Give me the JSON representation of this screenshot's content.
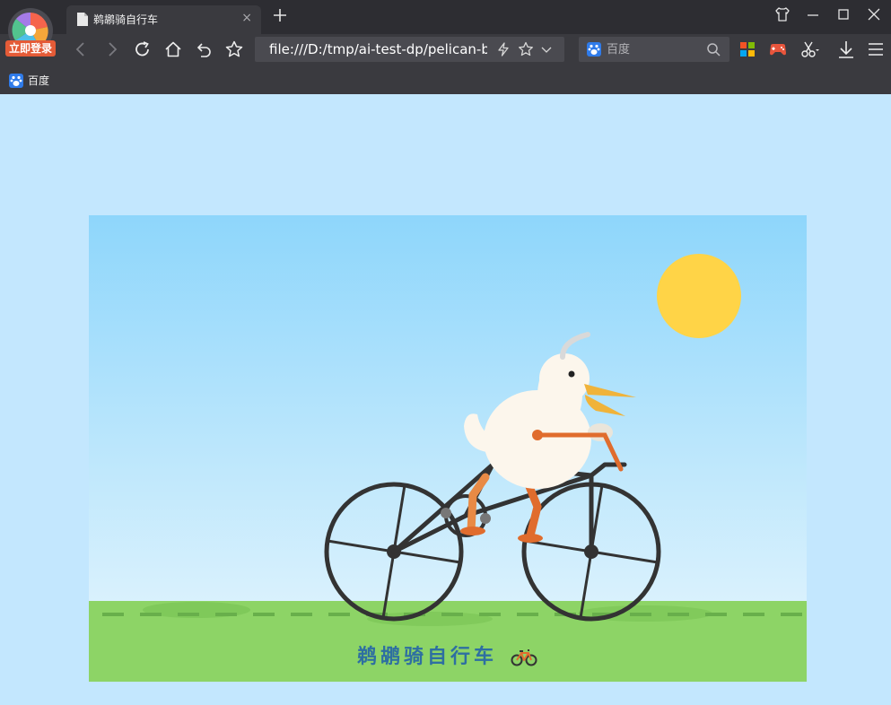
{
  "browser": {
    "account": {
      "login_label": "立即登录"
    },
    "tab": {
      "title": "鹈鹕骑自行车",
      "close_glyph": "×"
    },
    "address": {
      "url": "file:///D:/tmp/ai-test-dp/pelican-bicycle.html"
    },
    "search": {
      "placeholder": "百度",
      "engine_icon": "baidu-paw-icon"
    },
    "bookmarks": [
      {
        "label": "百度",
        "icon": "baidu-paw-icon"
      }
    ],
    "toolbar_icons": [
      "apps-grid-icon",
      "gamepad-icon",
      "scissors-icon",
      "download-icon",
      "menu-icon"
    ],
    "window_icons": [
      "skin-icon",
      "minimize-icon",
      "maximize-icon",
      "close-icon"
    ]
  },
  "page": {
    "caption": "鹈鹕骑自行车",
    "caption_emoji": "bicycle-icon",
    "colors": {
      "page_bg": "#C3E7FE",
      "sky_top": "#8ED6FB",
      "sky_bottom": "#D9F1FD",
      "grass": "#8DD466",
      "sun": "#FFD447",
      "pelican_body": "#FCF6EC",
      "beak": "#F0B33A",
      "legs": "#E06C2D",
      "bike_frame": "#333333",
      "caption": "#2E6FA1"
    }
  }
}
